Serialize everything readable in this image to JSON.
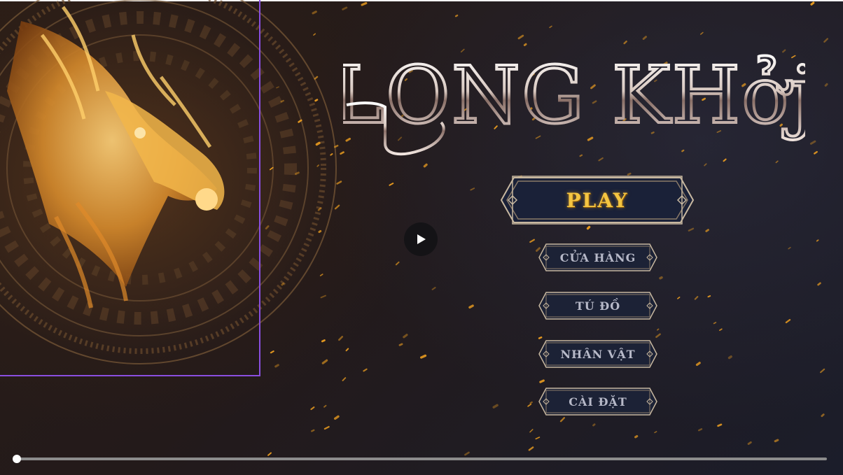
{
  "game": {
    "logo_text": "LONG KHởj"
  },
  "menu": {
    "play_label": "PLAY",
    "shop_label": "CỬA HÀNG",
    "inventory_label": "TÚ ĐỒ",
    "character_label": "NHÂN VẬT",
    "settings_label": "CÀI ĐẶT"
  },
  "video": {
    "progress": 0.0,
    "play_icon": "play-icon"
  },
  "colors": {
    "play_text": "#f4c542",
    "menu_text": "#b7b9c8",
    "button_fill": "#1c2236",
    "button_border": "#c8b8a0",
    "selection_outline": "#8a4fe0",
    "ember": "#f0a020"
  }
}
